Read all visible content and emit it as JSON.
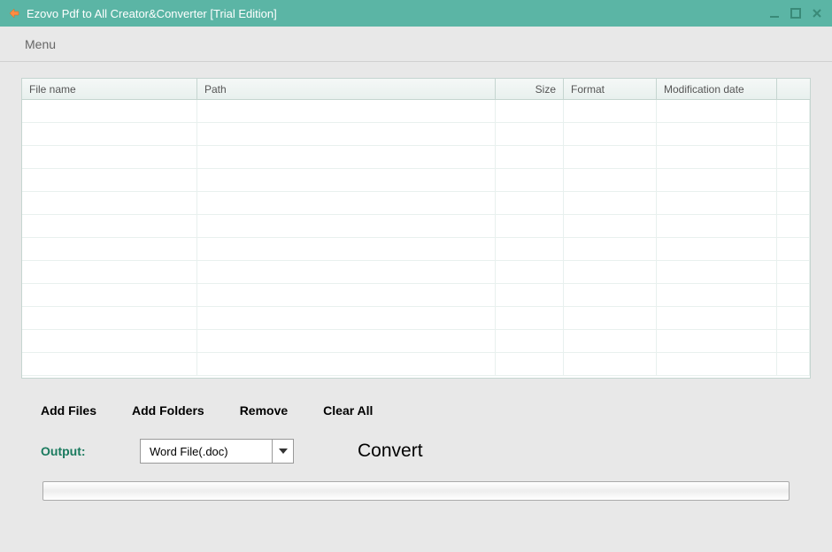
{
  "window": {
    "title": "Ezovo Pdf to All Creator&Converter [Trial Edition]"
  },
  "menu": {
    "label": "Menu"
  },
  "table": {
    "headers": {
      "filename": "File name",
      "path": "Path",
      "size": "Size",
      "format": "Format",
      "date": "Modification date"
    }
  },
  "actions": {
    "add_files": "Add Files",
    "add_folders": "Add Folders",
    "remove": "Remove",
    "clear_all": "Clear All"
  },
  "output": {
    "label": "Output:",
    "selected": "Word File(.doc)"
  },
  "convert": {
    "label": "Convert"
  }
}
